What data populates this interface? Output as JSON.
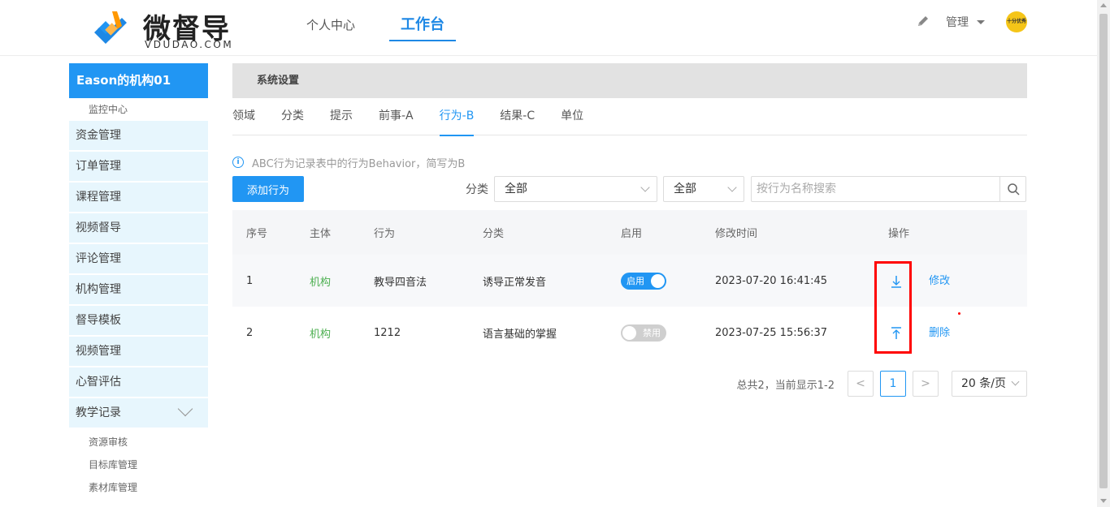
{
  "header": {
    "logo_name": "微督导",
    "logo_sub": "VDUDAO.COM",
    "nav": [
      {
        "label": "个人中心",
        "active": false
      },
      {
        "label": "工作台",
        "active": true
      }
    ],
    "admin_label": "管理",
    "avatar_text": "十分优秀"
  },
  "sidebar": {
    "org_name": "Eason的机构01",
    "monitor": "监控中心",
    "items": [
      "资金管理",
      "订单管理",
      "课程管理",
      "视频督导",
      "评论管理",
      "机构管理",
      "督导模板",
      "视频管理",
      "心智评估",
      "教学记录"
    ],
    "sub_items": [
      "资源审核",
      "目标库管理",
      "素材库管理"
    ]
  },
  "main": {
    "panel_title": "系统设置",
    "tabs": [
      "领域",
      "分类",
      "提示",
      "前事-A",
      "行为-B",
      "结果-C",
      "单位"
    ],
    "active_tab": "行为-B",
    "hint": "ABC行为记录表中的行为Behavior，简写为B",
    "add_button": "添加行为",
    "filter_label": "分类",
    "select1": "全部",
    "select2": "全部",
    "search_placeholder": "按行为名称搜索",
    "table": {
      "headers": [
        "序号",
        "主体",
        "行为",
        "分类",
        "启用",
        "修改时间",
        "操作"
      ],
      "rows": [
        {
          "no": "1",
          "subject": "机构",
          "behavior": "教导四音法",
          "category": "诱导正常发音",
          "enabled": true,
          "toggle_label": "启用",
          "time": "2023-07-20 16:41:45",
          "action": "修改"
        },
        {
          "no": "2",
          "subject": "机构",
          "behavior": "1212",
          "category": "语言基础的掌握",
          "enabled": false,
          "toggle_label": "禁用",
          "time": "2023-07-25 15:56:37",
          "action": "删除"
        }
      ]
    },
    "pagination": {
      "total_text": "总共2，当前显示1-2",
      "prev": "<",
      "current": "1",
      "next": ">",
      "page_size": "20 条/页"
    }
  },
  "colors": {
    "accent": "#2196f3",
    "sidebar_bg": "#e7f6fd",
    "subject_green": "#4caf50",
    "highlight_red": "#ff0000"
  }
}
